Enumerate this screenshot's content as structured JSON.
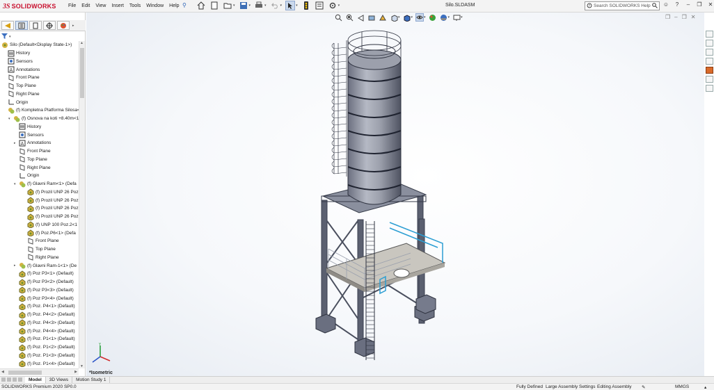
{
  "app": {
    "brand_ds": "3S",
    "brand_name": "SOLIDWORKS"
  },
  "menu": {
    "items": [
      "File",
      "Edit",
      "View",
      "Insert",
      "Tools",
      "Window",
      "Help"
    ]
  },
  "document": {
    "title": "Silo.SLDASM"
  },
  "search": {
    "placeholder": "Search SOLIDWORKS Help"
  },
  "tree": {
    "root": "Silo  (Default<Display State-1>)",
    "items": [
      "History",
      "Sensors",
      "Annotations",
      "Front Plane",
      "Top Plane",
      "Right Plane",
      "Origin",
      "(f) Kompletna Platforma Silosa<1",
      "(f) Osnova na koti +8.40m<1",
      "History",
      "Sensors",
      "Annotations",
      "Front Plane",
      "Top Plane",
      "Right Plane",
      "Origin",
      "(f) Glavni Ram<1> (Defa",
      "(f) Prozil UNP 26 Poz",
      "(f) Prozil UNP 26 Poz",
      "(f) Prozil UNP 26 Poz",
      "(f) Prozil UNP 26 Poz",
      "(f) UNP 100 Poz.2<1",
      "(f) Poz.P6<1> (Defa",
      "Front Plane",
      "Top Plane",
      "Right Plane",
      "(f) Glavni Ram-1<1> (De",
      "(f) Poz P3<1> (Default)",
      "(f) Poz P3<2> (Default)",
      "(f) Poz P3<3> (Default)",
      "(f) Poz P3<4> (Default)",
      "(f) Poz. P4<1> (Default)",
      "(f) Poz. P4<2> (Default)",
      "(f) Poz. P4<3> (Default)",
      "(f) Poz. P4<4> (Default)",
      "(f) Poz. P1<1> (Default)",
      "(f) Poz. P1<2> (Default)",
      "(f) Poz. P1<3> (Default)",
      "(f) Poz. P1<4> (Default)"
    ]
  },
  "view": {
    "orientation_label": "*Isometric"
  },
  "bottom_tabs": [
    "Model",
    "3D Views",
    "Motion Study 1"
  ],
  "status": {
    "product": "SOLIDWORKS Premium 2020 SP0.0",
    "defined": "Fully Defined",
    "settings": "Large Assembly Settings",
    "mode": "Editing Assembly",
    "units": "MMGS"
  },
  "colors": {
    "brand_red": "#c8102e",
    "accent_blue": "#2a62b6",
    "railing_cyan": "#2c9ed3"
  }
}
